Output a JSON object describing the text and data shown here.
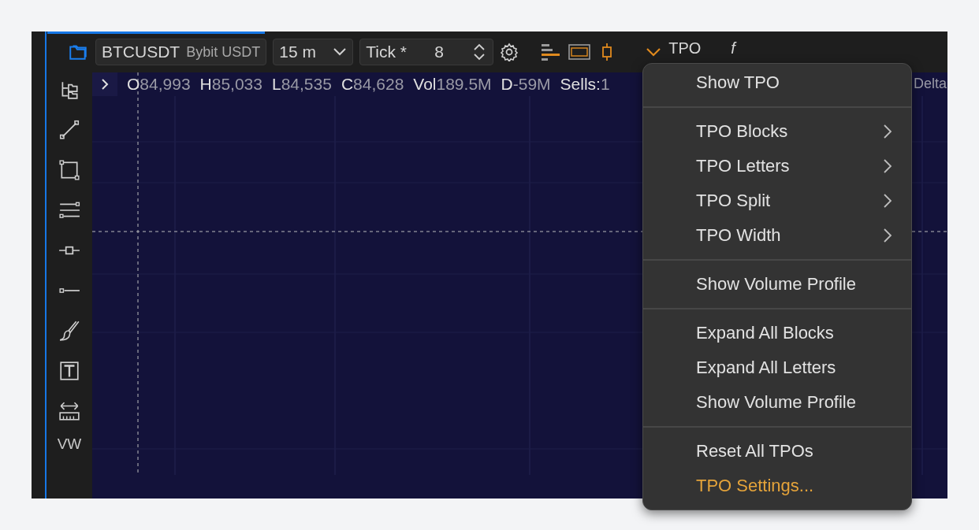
{
  "toolbar": {
    "symbol": "BTCUSDT",
    "exchange": "Bybit USDT",
    "interval": "15 m",
    "tick_label": "Tick *",
    "tick_value": "8",
    "indicator": "TPO",
    "formula": "f"
  },
  "info_bar": {
    "values": [
      {
        "label": "O",
        "value": "84,993"
      },
      {
        "label": "H",
        "value": "85,033"
      },
      {
        "label": "L",
        "value": "84,535"
      },
      {
        "label": "C",
        "value": "84,628"
      },
      {
        "label": "Vol",
        "value": "189.5M"
      },
      {
        "label": "D",
        "value": "-59M"
      },
      {
        "label": "Sells:",
        "value": "1"
      }
    ],
    "right_label": "Delta"
  },
  "sidebar": {
    "bottom_label": "VW"
  },
  "menu": {
    "groups": [
      [
        {
          "label": "Show TPO",
          "kind": "action"
        }
      ],
      [
        {
          "label": "TPO Blocks",
          "kind": "submenu"
        },
        {
          "label": "TPO Letters",
          "kind": "submenu"
        },
        {
          "label": "TPO Split",
          "kind": "submenu"
        },
        {
          "label": "TPO Width",
          "kind": "submenu"
        }
      ],
      [
        {
          "label": "Show Volume Profile",
          "kind": "action"
        }
      ],
      [
        {
          "label": "Expand All Blocks",
          "kind": "action"
        },
        {
          "label": "Expand All Letters",
          "kind": "action"
        },
        {
          "label": "Show Volume Profile",
          "kind": "action"
        }
      ],
      [
        {
          "label": "Reset All TPOs",
          "kind": "action"
        },
        {
          "label": "TPO Settings...",
          "kind": "settings"
        }
      ]
    ]
  }
}
